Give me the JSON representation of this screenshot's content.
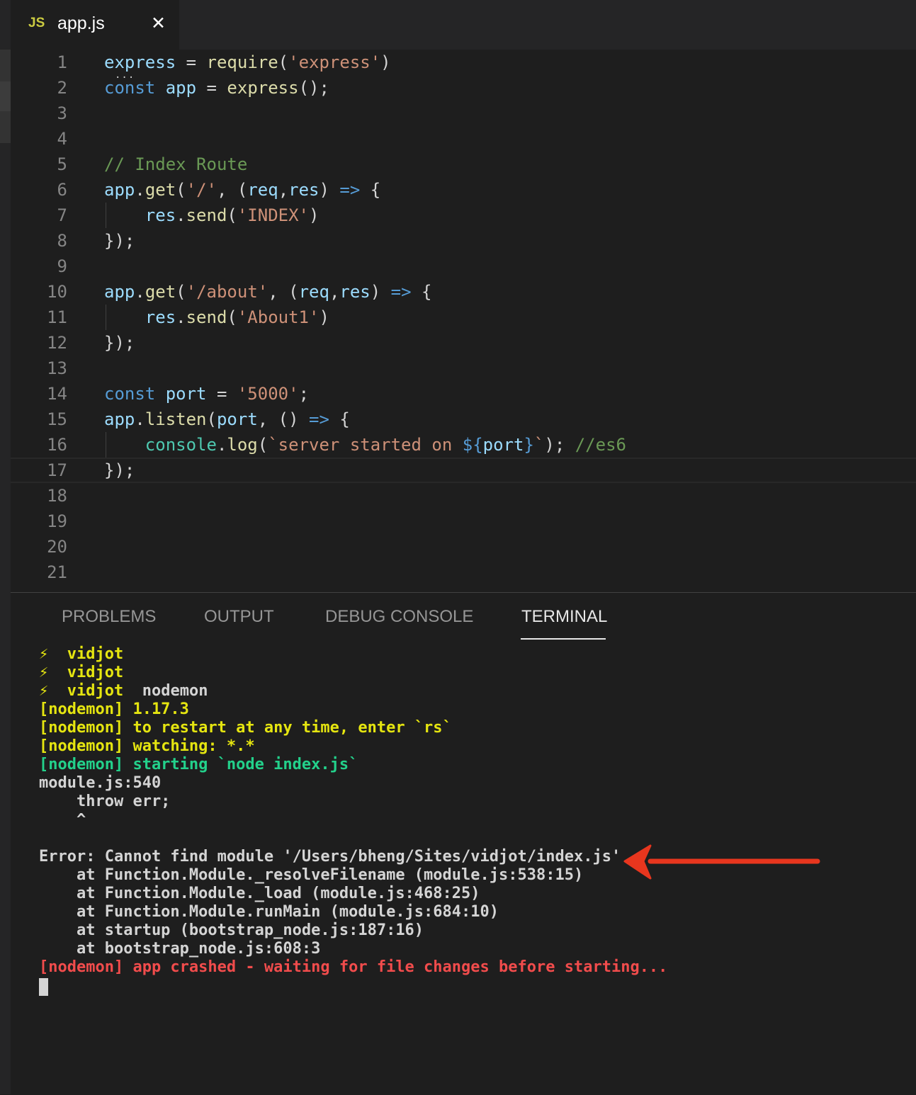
{
  "tab": {
    "icon": "JS",
    "title": "app.js",
    "close": "✕"
  },
  "editor": {
    "lines": [
      {
        "n": "1"
      },
      {
        "n": "2"
      },
      {
        "n": "3"
      },
      {
        "n": "4"
      },
      {
        "n": "5"
      },
      {
        "n": "6"
      },
      {
        "n": "7"
      },
      {
        "n": "8"
      },
      {
        "n": "9"
      },
      {
        "n": "10"
      },
      {
        "n": "11"
      },
      {
        "n": "12"
      },
      {
        "n": "13"
      },
      {
        "n": "14"
      },
      {
        "n": "15"
      },
      {
        "n": "16"
      },
      {
        "n": "17"
      },
      {
        "n": "18"
      },
      {
        "n": "19"
      },
      {
        "n": "20"
      },
      {
        "n": "21"
      }
    ],
    "code": {
      "l1": {
        "a": "express",
        "b": " = ",
        "c": "require",
        "d": "(",
        "e": "'express'",
        "f": ")"
      },
      "l2": {
        "a": "const",
        "b": " ",
        "c": "app",
        "d": " = ",
        "e": "express",
        "f": "();"
      },
      "l5": {
        "a": "// Index Route"
      },
      "l6": {
        "a": "app",
        "b": ".",
        "c": "get",
        "d": "(",
        "e": "'/'",
        "f": ", (",
        "g": "req",
        "h": ",",
        "i": "res",
        "j": ") ",
        "k": "=>",
        "l": " {"
      },
      "l7": {
        "a": "    ",
        "b": "res",
        "c": ".",
        "d": "send",
        "e": "(",
        "f": "'INDEX'",
        "g": ")"
      },
      "l8": {
        "a": "});"
      },
      "l10": {
        "a": "app",
        "b": ".",
        "c": "get",
        "d": "(",
        "e": "'/about'",
        "f": ", (",
        "g": "req",
        "h": ",",
        "i": "res",
        "j": ") ",
        "k": "=>",
        "l": " {"
      },
      "l11": {
        "a": "    ",
        "b": "res",
        "c": ".",
        "d": "send",
        "e": "(",
        "f": "'About1'",
        "g": ")"
      },
      "l12": {
        "a": "});"
      },
      "l14": {
        "a": "const",
        "b": " ",
        "c": "port",
        "d": " = ",
        "e": "'5000'",
        "f": ";"
      },
      "l15": {
        "a": "app",
        "b": ".",
        "c": "listen",
        "d": "(",
        "e": "port",
        "f": ", () ",
        "g": "=>",
        "h": " {"
      },
      "l16": {
        "a": "    ",
        "b": "console",
        "c": ".",
        "d": "log",
        "e": "(",
        "f": "`server started on ",
        "g": "${",
        "h": "port",
        "i": "}",
        "j": "`",
        "k": "); ",
        "l": "//es6"
      },
      "l17": {
        "a": "});"
      }
    }
  },
  "panel": {
    "tabs": {
      "problems": "PROBLEMS",
      "output": "OUTPUT",
      "debug": "DEBUG CONSOLE",
      "terminal": "TERMINAL"
    }
  },
  "terminal": {
    "bolt": "⚡",
    "l1": "vidjot",
    "l2": "vidjot",
    "l3a": "vidjot",
    "l3b": "  nodemon",
    "l4": "[nodemon] 1.17.3",
    "l5": "[nodemon] to restart at any time, enter `rs`",
    "l6": "[nodemon] watching: *.*",
    "l7": "[nodemon] starting `node index.js`",
    "l8": "module.js:540",
    "l9": "    throw err;",
    "l10": "    ^",
    "l12": "Error: Cannot find module '/Users/bheng/Sites/vidjot/index.js'",
    "l13": "    at Function.Module._resolveFilename (module.js:538:15)",
    "l14": "    at Function.Module._load (module.js:468:25)",
    "l15": "    at Function.Module.runMain (module.js:684:10)",
    "l16": "    at startup (bootstrap_node.js:187:16)",
    "l17": "    at bootstrap_node.js:608:3",
    "l18": "[nodemon] app crashed - waiting for file changes before starting..."
  },
  "colors": {
    "annotation_arrow": "#e8361e",
    "editor_bg": "#1e1e1e",
    "keyword": "#569cd6",
    "string": "#ce9178"
  },
  "icons": {
    "file_type": "js-icon",
    "close": "close-icon",
    "annotation": "red-arrow"
  }
}
